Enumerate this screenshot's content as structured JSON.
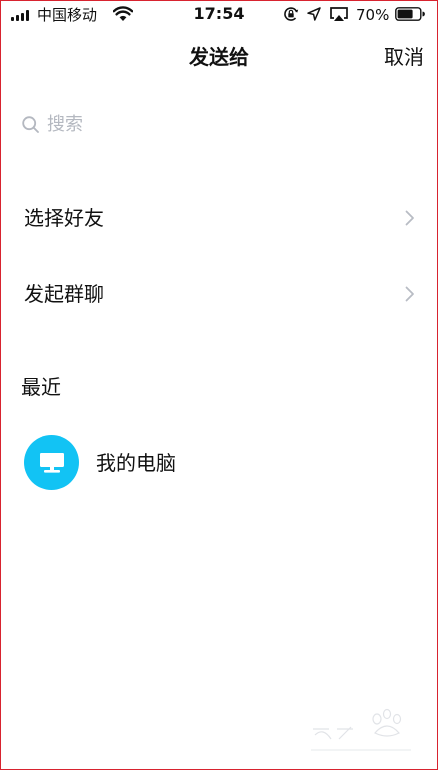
{
  "status_bar": {
    "carrier": "中国移动",
    "time": "17:54",
    "battery_percent": "70%",
    "battery_level": 0.7
  },
  "nav": {
    "title": "发送给",
    "cancel_label": "取消"
  },
  "search": {
    "placeholder": "搜索"
  },
  "menu": {
    "items": [
      {
        "label": "选择好友"
      },
      {
        "label": "发起群聊"
      }
    ]
  },
  "recent": {
    "section_title": "最近",
    "items": [
      {
        "name": "我的电脑",
        "avatar_color": "#12c3f4",
        "avatar_icon": "computer-monitor-icon"
      }
    ]
  },
  "colors": {
    "accent": "#12c3f4",
    "placeholder": "#b4b8c0",
    "chevron": "#b8bcc4",
    "frame_border": "#d8232f"
  }
}
